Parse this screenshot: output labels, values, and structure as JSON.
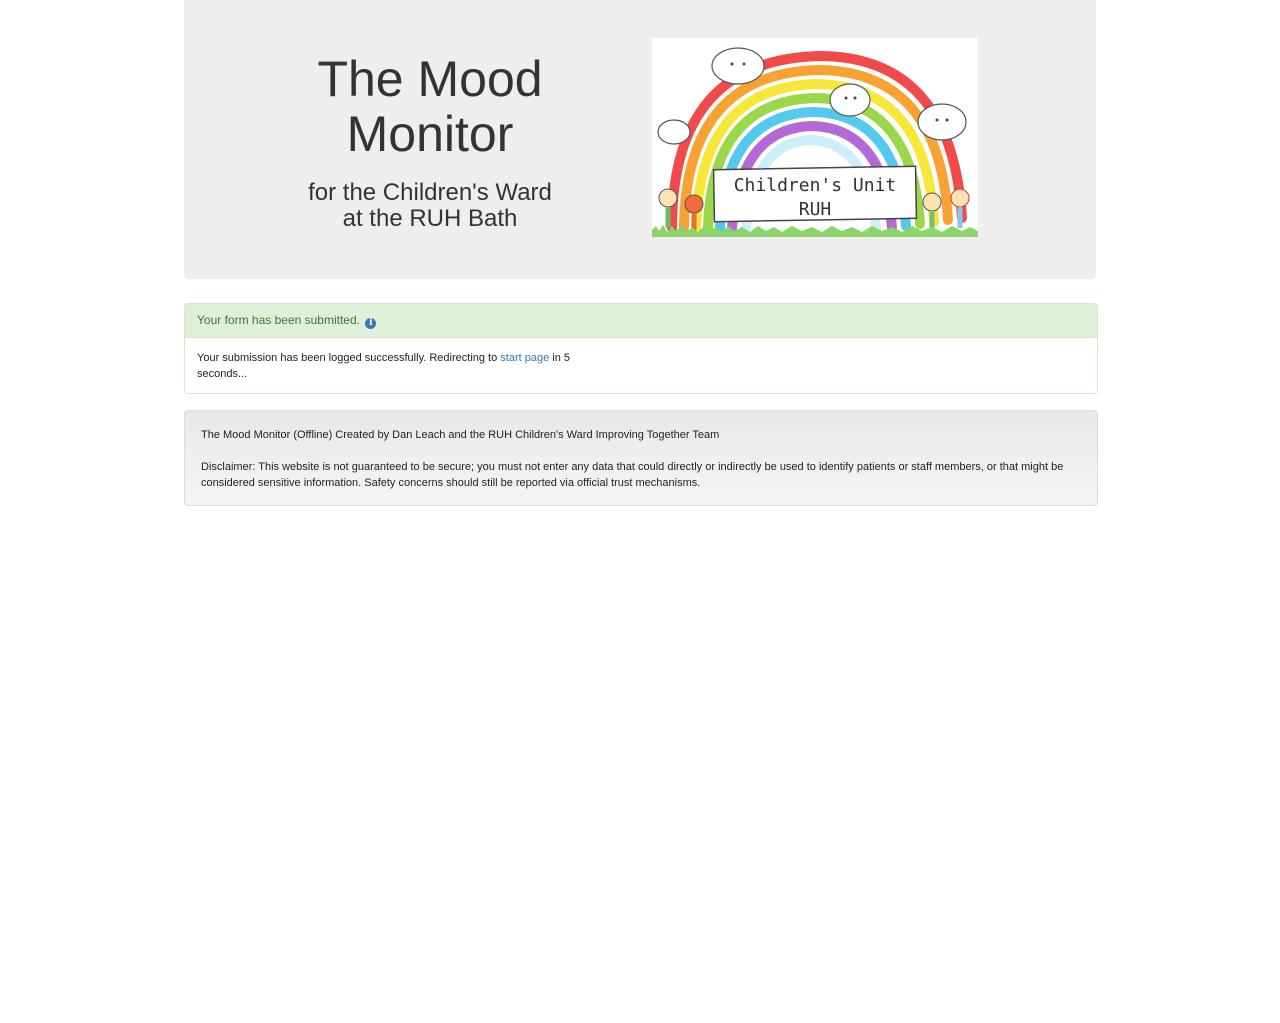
{
  "header": {
    "title": "The Mood Monitor",
    "subtitle_line1": "for the Children's Ward",
    "subtitle_line2": "at the RUH Bath",
    "logo": {
      "banner_line1": "Children's Unit",
      "banner_line2": "RUH",
      "rainbow_colors": [
        "#f04a4a",
        "#f7a233",
        "#f5e83a",
        "#9ad84a",
        "#55c8ee",
        "#b46ad6"
      ]
    }
  },
  "alert": {
    "heading": "Your form has been submitted.",
    "info_icon": "info-circle-icon",
    "body_prefix": "Your submission has been logged successfully. Redirecting to",
    "link_text": "start page",
    "body_suffix_line1": "in 5",
    "body_suffix_line2": "seconds..."
  },
  "footer": {
    "credits": "The Mood Monitor (Offline) Created by Dan Leach and the RUH Children's Ward Improving Together Team",
    "disclaimer": "Disclaimer: This website is not guaranteed to be secure; you must not enter any data that could directly or indirectly be used to identify patients or staff members, or that might be considered sensitive information. Safety concerns should still be reported via official trust mechanisms."
  }
}
